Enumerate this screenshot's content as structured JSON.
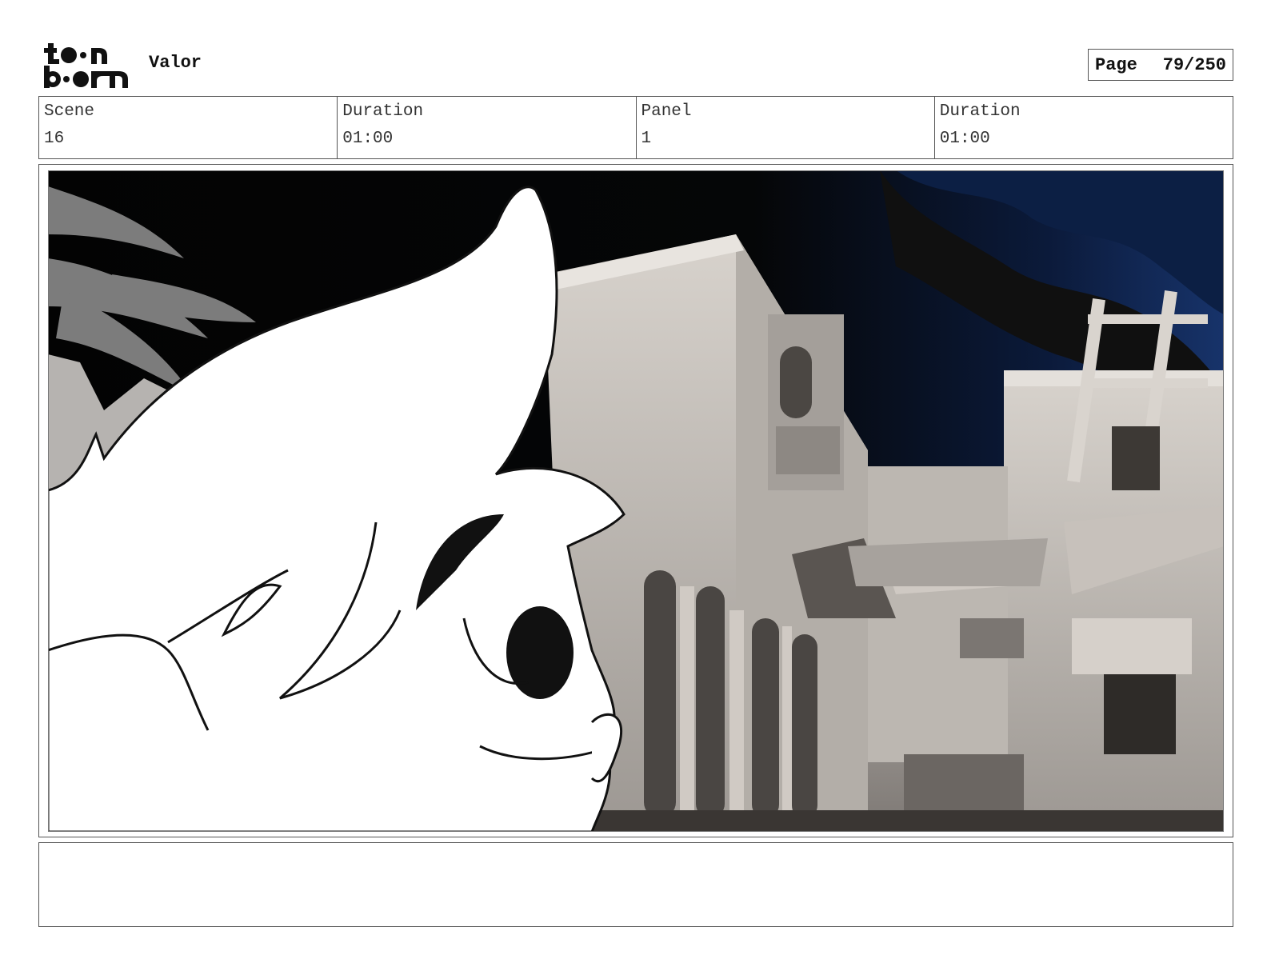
{
  "header": {
    "logo_text": "toon boom",
    "project_title": "Valor",
    "page_label": "Page",
    "page_number": "79/250"
  },
  "info": {
    "scene_label": "Scene",
    "scene_value": "16",
    "scene_duration_label": "Duration",
    "scene_duration_value": "01:00",
    "panel_label": "Panel",
    "panel_value": "1",
    "panel_duration_label": "Duration",
    "panel_duration_value": "01:00"
  },
  "panel": {
    "image_description_icon": "storyboard-panel-image"
  },
  "notes": {
    "text": ""
  }
}
